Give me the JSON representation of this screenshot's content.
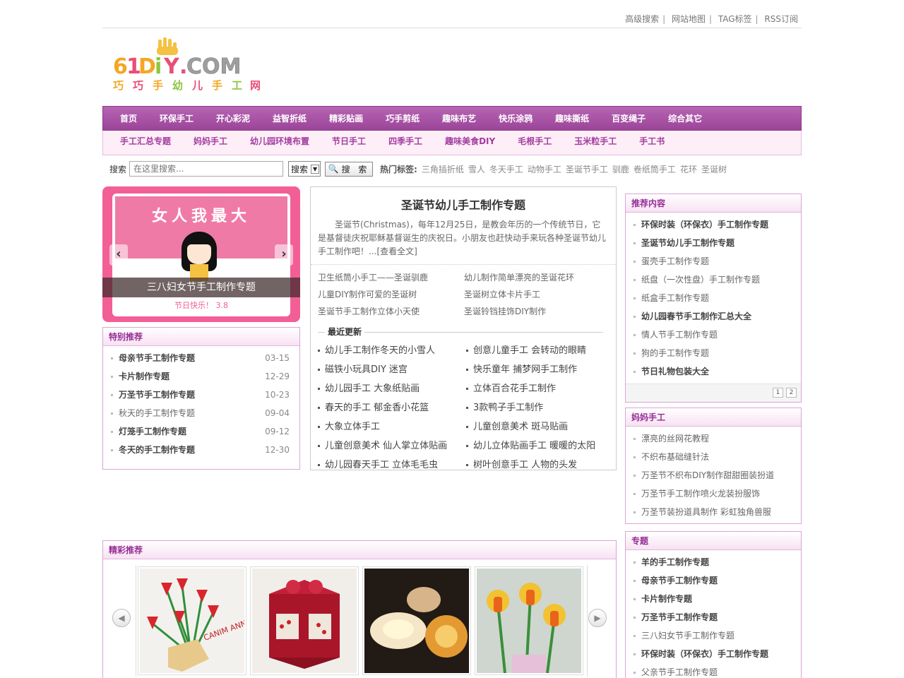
{
  "top_links": [
    "高级搜索",
    "网站地图",
    "TAG标签",
    "RSS订阅"
  ],
  "logo": {
    "text": "61DIY.COM",
    "subtitle": "巧巧手幼儿手工网"
  },
  "nav_primary": [
    "首页",
    "环保手工",
    "开心彩泥",
    "益智折纸",
    "精彩贴画",
    "巧手剪纸",
    "趣味布艺",
    "快乐涂鸦",
    "趣味撕纸",
    "百变绳子",
    "综合其它"
  ],
  "nav_secondary": [
    "手工汇总专题",
    "妈妈手工",
    "幼儿园环境布置",
    "节日手工",
    "四季手工",
    "趣味美食DIY",
    "毛根手工",
    "玉米粒手工",
    "手工书"
  ],
  "search": {
    "label": "搜索",
    "placeholder": "在这里搜索...",
    "select_value": "搜索",
    "button_label": "搜 索",
    "hot_label": "热门标签:",
    "hot_tags": [
      "三角插折纸",
      "雪人",
      "冬天手工",
      "动物手工",
      "圣诞节手工",
      "驯鹿",
      "卷纸筒手工",
      "花环",
      "圣诞树"
    ]
  },
  "slider": {
    "image_text": "女人我最大",
    "caption": "三八妇女节手工制作专题",
    "sub_text": "节日快乐！",
    "sub_date": "3.8",
    "prev": "‹",
    "next": "›"
  },
  "special": {
    "title": "特别推荐",
    "items": [
      {
        "text": "母亲节手工制作专题",
        "date": "03-15",
        "bold": true
      },
      {
        "text": "卡片制作专题",
        "date": "12-29",
        "bold": true
      },
      {
        "text": "万圣节手工制作专题",
        "date": "10-23",
        "bold": true
      },
      {
        "text": "秋天的手工制作专题",
        "date": "09-04",
        "bold": false
      },
      {
        "text": "灯笼手工制作专题",
        "date": "09-12",
        "bold": true
      },
      {
        "text": "冬天的手工制作专题",
        "date": "12-30",
        "bold": true
      }
    ]
  },
  "feature": {
    "title": "圣诞节幼儿手工制作专题",
    "intro": "圣诞节(Christmas)，每年12月25日，是教会年历的一个传统节日，它是基督徒庆祝耶稣基督诞生的庆祝日。小朋友也赶快动手来玩各种圣诞节幼儿手工制作吧！...[查看全文]",
    "links": [
      "卫生纸筒小手工——圣诞驯鹿",
      "幼儿制作简单漂亮的圣诞花环",
      "儿童DIY制作可爱的圣诞树",
      "圣诞树立体卡片手工",
      "圣诞节手工制作立体小天使",
      "圣诞铃铛挂饰DIY制作"
    ],
    "latest_title": "最近更新",
    "latest": [
      "幼儿手工制作冬天的小雪人",
      "创意儿童手工 会转动的眼睛",
      "磁铁小玩具DIY 迷宫",
      "快乐童年 捕梦网手工制作",
      "幼儿园手工 大象纸贴画",
      "立体百合花手工制作",
      "春天的手工 郁金香小花篮",
      "3款鸭子手工制作",
      "大象立体手工",
      "儿童创意美术 斑马贴画",
      "儿童创意美术 仙人掌立体贴画",
      "幼儿立体贴画手工 暖暖的太阳",
      "幼儿园春天手工 立体毛毛虫",
      "树叶创意手工 人物的头发"
    ]
  },
  "recommend": {
    "title": "推荐内容",
    "items": [
      {
        "text": "环保时装（环保衣）手工制作专题",
        "bold": true
      },
      {
        "text": "圣诞节幼儿手工制作专题",
        "bold": true
      },
      {
        "text": "蛋壳手工制作专题",
        "bold": false
      },
      {
        "text": "纸盘（一次性盘）手工制作专题",
        "bold": false
      },
      {
        "text": "纸盒手工制作专题",
        "bold": false
      },
      {
        "text": "幼儿园春节手工制作汇总大全",
        "bold": true
      },
      {
        "text": "情人节手工制作专题",
        "bold": false
      },
      {
        "text": "狗的手工制作专题",
        "bold": false
      },
      {
        "text": "节日礼物包装大全",
        "bold": true
      }
    ],
    "pages": [
      "1",
      "2"
    ]
  },
  "mama": {
    "title": "妈妈手工",
    "items": [
      "漂亮的丝网花教程",
      "不织布基础缝针法",
      "万圣节不织布DIY制作甜甜圈装扮道",
      "万圣节手工制作喷火龙装扮服饰",
      "万圣节装扮道具制作 彩虹独角兽服"
    ]
  },
  "topics": {
    "title": "专题",
    "items": [
      {
        "text": "羊的手工制作专题",
        "bold": true
      },
      {
        "text": "母亲节手工制作专题",
        "bold": true
      },
      {
        "text": "卡片制作专题",
        "bold": true
      },
      {
        "text": "万圣节手工制作专题",
        "bold": true
      },
      {
        "text": "三八妇女节手工制作专题",
        "bold": false
      },
      {
        "text": "环保时装（环保衣）手工制作专题",
        "bold": true
      },
      {
        "text": "父亲节手工制作专题",
        "bold": false
      }
    ]
  },
  "showcase": {
    "title": "精彩推荐",
    "prev": "◀",
    "next": "▶",
    "card_text": "CANIM ANNEME"
  },
  "colors": {
    "nav_purple": "#a44ea1",
    "accent": "#962c95",
    "pink": "#f25f96"
  }
}
